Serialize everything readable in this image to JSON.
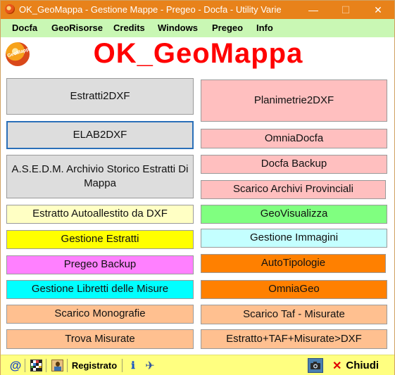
{
  "window": {
    "title": "OK_GeoMappa - Gestione Mappe - Pregeo - Docfa - Utility Varie",
    "min_glyph": "—",
    "max_glyph": "☐",
    "close_glyph": "✕"
  },
  "menu": {
    "items": [
      "Docfa",
      "GeoRisorse",
      "Credits",
      "Windows",
      "Pregeo",
      "Info"
    ]
  },
  "header": {
    "app_title": "OK_GeoMappa",
    "logo_text": "GeoMappa",
    "logo_icon": "geomappa-logo-icon"
  },
  "left_buttons": [
    {
      "label": "Estratti2DXF",
      "color": "#dddddd"
    },
    {
      "label": "ELAB2DXF",
      "color": "#dddddd"
    },
    {
      "label": "A.S.E.D.M. Archivio Storico Estratti Di Mappa",
      "color": "#dddddd"
    },
    {
      "label": "Estratto Autoallestito da DXF",
      "color": "#ffffc4"
    },
    {
      "label": "Gestione Estratti",
      "color": "#ffff00"
    },
    {
      "label": "Pregeo Backup",
      "color": "#ff80ff"
    },
    {
      "label": "Gestione Libretti delle Misure",
      "color": "#00ffff"
    },
    {
      "label": "Scarico Monografie",
      "color": "#ffc090"
    },
    {
      "label": "Trova Misurate",
      "color": "#ffc090"
    }
  ],
  "right_buttons": [
    {
      "label": "Planimetrie2DXF",
      "color": "#ffbfbf"
    },
    {
      "label": "OmniaDocfa",
      "color": "#ffbfbf"
    },
    {
      "label": "Docfa Backup",
      "color": "#ffbfbf"
    },
    {
      "label": "Scarico Archivi Provinciali",
      "color": "#ffbfbf"
    },
    {
      "label": "GeoVisualizza",
      "color": "#80ff80"
    },
    {
      "label": "Gestione Immagini",
      "color": "#c4ffff"
    },
    {
      "label": "AutoTipologie",
      "color": "#ff8000"
    },
    {
      "label": "OmniaGeo",
      "color": "#ff8000"
    },
    {
      "label": "Scarico Taf - Misurate",
      "color": "#ffc090"
    },
    {
      "label": "Estratto+TAF+Misurate>DXF",
      "color": "#ffc090"
    }
  ],
  "statusbar": {
    "at_glyph": "@",
    "registrato": "Registrato",
    "info_glyph": "ℹ",
    "telegram_glyph": "✈",
    "camera_glyph": "📷",
    "close_glyph": "✕",
    "chiudi": "Chiudi"
  }
}
